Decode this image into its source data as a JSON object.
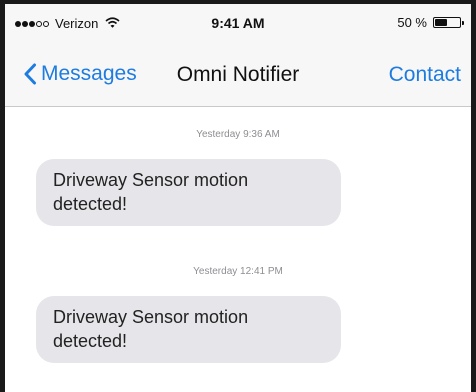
{
  "status_bar": {
    "carrier": "Verizon",
    "signal_bars_filled": 3,
    "signal_bars_total": 5,
    "time": "9:41 AM",
    "battery_percent": "50 %",
    "battery_level": 0.5
  },
  "nav": {
    "back_label": "Messages",
    "title": "Omni Notifier",
    "right_label": "Contact"
  },
  "messages": [
    {
      "timestamp": "Yesterday 9:36 AM",
      "text": "Driveway Sensor motion detected!"
    },
    {
      "timestamp": "Yesterday 12:41 PM",
      "text": "Driveway Sensor motion detected!"
    }
  ],
  "colors": {
    "accent": "#1e7ce0",
    "bubble": "#e5e5ea",
    "bar_bg": "#f7f7f7"
  },
  "icons": {
    "back": "chevron-left-icon",
    "wifi": "wifi-icon",
    "battery": "battery-icon",
    "signal": "signal-dots-icon"
  }
}
